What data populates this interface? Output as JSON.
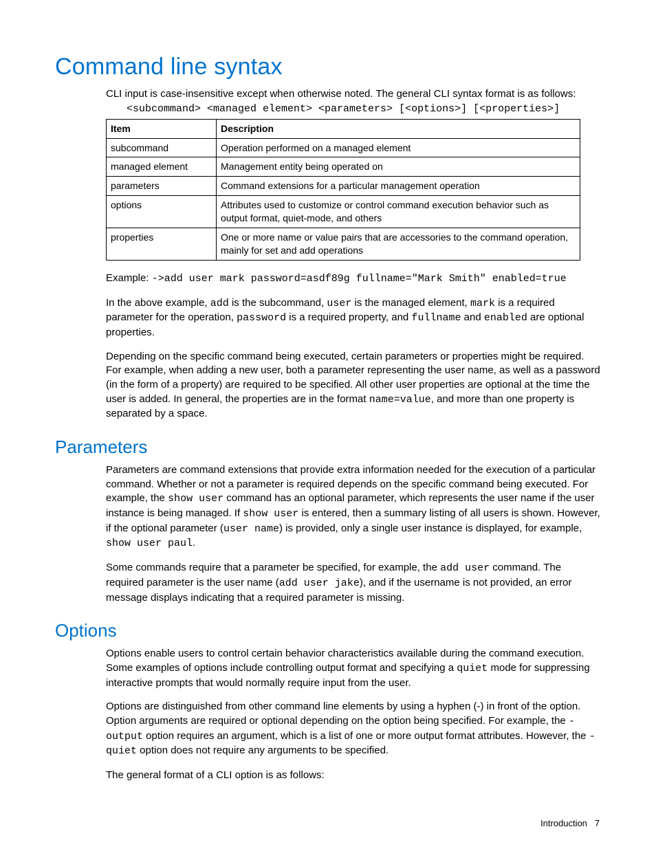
{
  "h1": "Command line syntax",
  "intro": "CLI input is case-insensitive except when otherwise noted. The general CLI syntax format is as follows:",
  "syntax": "<subcommand> <managed element> <parameters> [<options>] [<properties>]",
  "table": {
    "headers": [
      "Item",
      "Description"
    ],
    "rows": [
      [
        "subcommand",
        "Operation performed on a managed element"
      ],
      [
        "managed element",
        "Management entity being operated on"
      ],
      [
        "parameters",
        "Command extensions for a particular management operation"
      ],
      [
        "options",
        "Attributes used to customize or control command execution behavior such as output format, quiet-mode, and others"
      ],
      [
        "properties",
        "One or more name or value pairs that are accessories to the command operation, mainly for set and add operations"
      ]
    ]
  },
  "example_label": "Example: ",
  "example_code": "->add user mark password=asdf89g fullname=\"Mark Smith\" enabled=true",
  "p1": {
    "a": "In the above example, ",
    "b": "add",
    "c": " is the subcommand, ",
    "d": "user",
    "e": " is the managed element, ",
    "f": "mark",
    "g": " is a required parameter for the operation, ",
    "h": "password",
    "i": " is a required property, and ",
    "j": "fullname",
    "k": " and ",
    "l": "enabled",
    "m": " are optional properties."
  },
  "p2": {
    "a": "Depending on the specific command being executed, certain parameters or properties might be required. For example, when adding a new user, both a parameter representing the user name, as well as a password (in the form of a property) are required to be specified. All other user properties are optional at the time the user is added. In general, the properties are in the format ",
    "b": "name=value",
    "c": ", and more than one property is separated by a space."
  },
  "h2a": "Parameters",
  "p3": {
    "a": "Parameters are command extensions that provide extra information needed for the execution of a particular command. Whether or not a parameter is required depends on the specific command being executed. For example, the ",
    "b": "show user",
    "c": " command has an optional parameter, which represents the user name if the user instance is being managed. If ",
    "d": "show user",
    "e": " is entered, then a summary listing of all users is shown. However, if the optional parameter (",
    "f": "user name",
    "g": ") is provided, only a single user instance is displayed, for example, ",
    "h": "show user paul",
    "i": "."
  },
  "p4": {
    "a": "Some commands require that a parameter be specified, for example, the ",
    "b": "add user",
    "c": " command. The required parameter is the user name (",
    "d": "add user jake",
    "e": "), and if the username is not provided, an error message displays indicating that a required parameter is missing."
  },
  "h2b": "Options",
  "p5": {
    "a": "Options enable users to control certain behavior characteristics available during the command execution. Some examples of options include controlling output format and specifying a ",
    "b": "quiet",
    "c": " mode for suppressing interactive prompts that would normally require input from the user."
  },
  "p6": {
    "a": "Options are distinguished from other command line elements by using a hyphen (-) in front of the option. Option arguments are required or optional depending on the option being specified. For example, the ",
    "b": "-output",
    "c": " option requires an argument, which is a list of one or more output format attributes. However, the ",
    "d": "-quiet",
    "e": " option does not require any arguments to be specified."
  },
  "p7": "The general format of a CLI option is as follows:",
  "footer": {
    "label": "Introduction",
    "page": "7"
  }
}
